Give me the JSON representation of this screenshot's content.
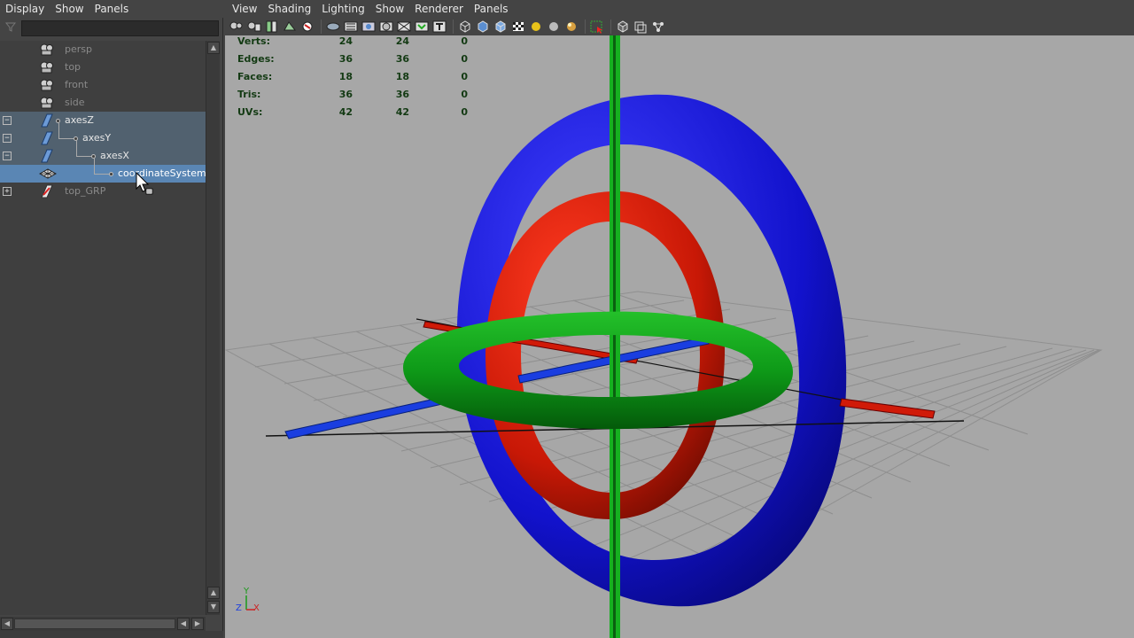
{
  "outliner": {
    "menu": [
      "Display",
      "Show",
      "Panels"
    ],
    "filter_value": "",
    "items": [
      {
        "label": "persp",
        "type": "camera",
        "dim": true
      },
      {
        "label": "top",
        "type": "camera",
        "dim": true
      },
      {
        "label": "front",
        "type": "camera",
        "dim": true
      },
      {
        "label": "side",
        "type": "camera",
        "dim": true
      },
      {
        "label": "axesZ",
        "type": "transform",
        "expander": "−"
      },
      {
        "label": "axesY",
        "type": "transform",
        "expander": "−"
      },
      {
        "label": "axesX",
        "type": "transform",
        "expander": "−"
      },
      {
        "label": "coordinateSystem",
        "type": "mesh",
        "selected": true
      },
      {
        "label": "top_GRP",
        "type": "group",
        "expander": "+",
        "dim": true
      }
    ]
  },
  "viewport": {
    "menu": [
      "View",
      "Shading",
      "Lighting",
      "Show",
      "Renderer",
      "Panels"
    ],
    "hud": [
      {
        "label": "Verts:",
        "v1": "24",
        "v2": "24",
        "v3": "0"
      },
      {
        "label": "Edges:",
        "v1": "36",
        "v2": "36",
        "v3": "0"
      },
      {
        "label": "Faces:",
        "v1": "18",
        "v2": "18",
        "v3": "0"
      },
      {
        "label": "Tris:",
        "v1": "36",
        "v2": "36",
        "v3": "0"
      },
      {
        "label": "UVs:",
        "v1": "42",
        "v2": "42",
        "v3": "0"
      }
    ],
    "gizmo": {
      "x": "X",
      "y": "Y",
      "z": "Z"
    }
  },
  "colors": {
    "viewport_bg": "#a7a7a7",
    "grid": "#8f8f8f",
    "torus_blue": "#1010d8",
    "torus_red": "#d01a08",
    "torus_green": "#0c9a18",
    "selection": "#5a86b4"
  },
  "icons": {
    "toolbar": [
      "select-camera-icon",
      "camera-attr-icon",
      "bookmark-icon",
      "image-plane-icon",
      "grid-icon",
      "film-gate-icon",
      "resolution-gate-icon",
      "gate-mask-icon",
      "field-chart-icon",
      "safe-action-icon",
      "safe-title-icon",
      "wireframe-icon",
      "smooth-shade-icon",
      "default-material-icon",
      "texture-icon",
      "use-all-lights-icon",
      "shadows-icon",
      "high-quality-icon",
      "isolate-select-icon",
      "xray-icon",
      "xray-joints-icon",
      "xray-components-icon"
    ]
  }
}
